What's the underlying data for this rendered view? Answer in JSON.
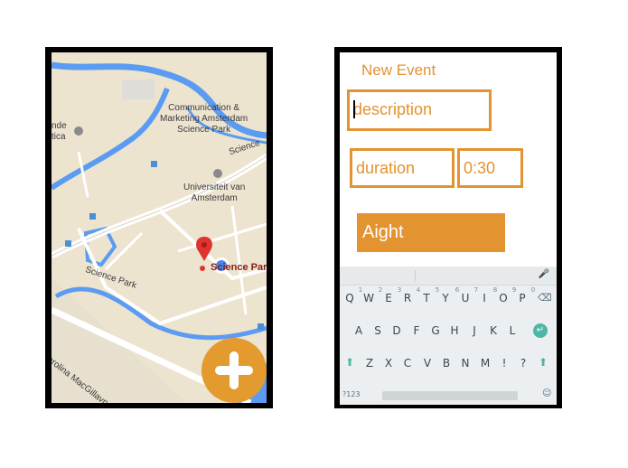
{
  "map_screen": {
    "labels": {
      "comm_marketing": "Communication &\nMarketing Amsterdam\nScience Park",
      "science_top": "Science",
      "nde": "nde",
      "tica": "tica",
      "uva": "Universiteit van\nAmsterdam",
      "science_park_road": "Science Park",
      "science_park_poi": "Science Par",
      "carolina": "Carolina MacGillavrylaan"
    },
    "fab_icon": "plus-icon",
    "colors": {
      "fab": "#e39a2e",
      "water": "#5b9cf2",
      "land": "#ede4d0",
      "marker": "#e0322f"
    }
  },
  "event_form": {
    "title": "New Event",
    "description_field": {
      "placeholder": "description"
    },
    "duration_field": {
      "label": "duration"
    },
    "duration_value": "0:30",
    "submit_label": "Aight",
    "accent_color": "#e3932f"
  },
  "keyboard": {
    "row1_keys": [
      "Q",
      "W",
      "E",
      "R",
      "T",
      "Y",
      "U",
      "I",
      "O",
      "P"
    ],
    "row1_hints": [
      "1",
      "2",
      "3",
      "4",
      "5",
      "6",
      "7",
      "8",
      "9",
      "0"
    ],
    "row2_keys": [
      "A",
      "S",
      "D",
      "F",
      "G",
      "H",
      "J",
      "K",
      "L"
    ],
    "row3_keys": [
      "Z",
      "X",
      "C",
      "V",
      "B",
      "N",
      "M",
      "!",
      "?"
    ],
    "numbers_key": "?123",
    "mic_icon": "mic-icon",
    "backspace_icon": "backspace-icon",
    "enter_icon": "enter-icon",
    "shift_icon": "shift-icon",
    "emoji_icon": "emoji-icon"
  }
}
